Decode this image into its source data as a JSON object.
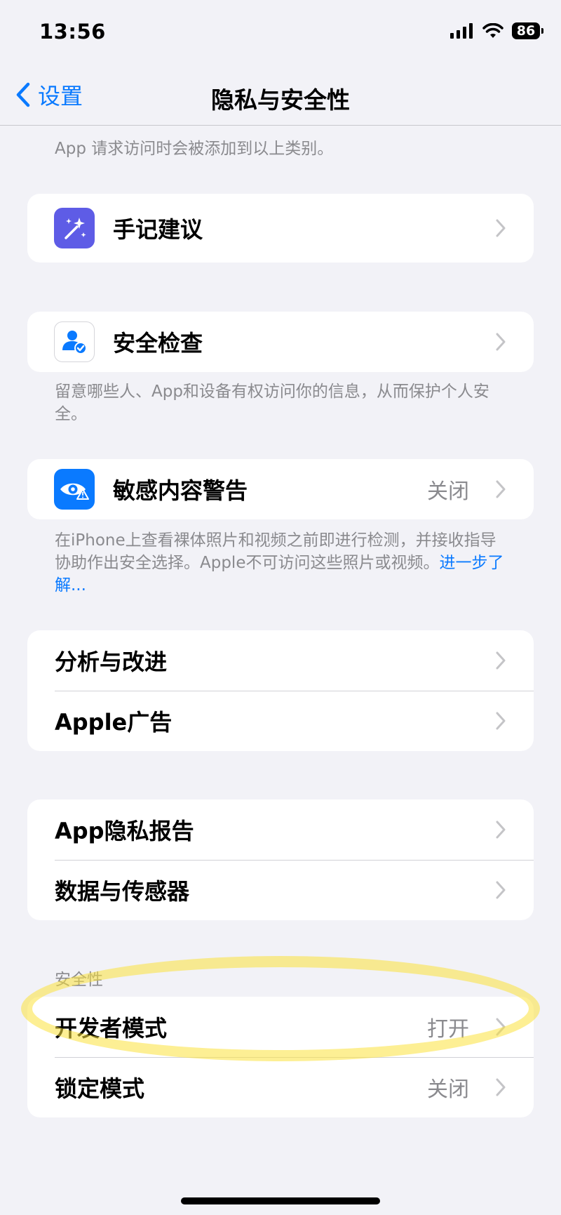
{
  "status": {
    "time": "13:56",
    "battery": "86"
  },
  "nav": {
    "back_label": "设置",
    "title": "隐私与安全性"
  },
  "top_note": "App 请求访问时会被添加到以上类别。",
  "journaling": {
    "label": "手记建议"
  },
  "safety_check": {
    "label": "安全检查",
    "footnote": "留意哪些人、App和设备有权访问你的信息，从而保护个人安全。"
  },
  "sensitive": {
    "label": "敏感内容警告",
    "value": "关闭",
    "footnote": "在iPhone上查看裸体照片和视频之前即进行检测，并接收指导协助作出安全选择。Apple不可访问这些照片或视频。",
    "link": "进一步了解..."
  },
  "group_analytics": {
    "items": [
      {
        "label": "分析与改进"
      },
      {
        "label": "Apple广告"
      }
    ]
  },
  "group_report": {
    "items": [
      {
        "label": "App隐私报告"
      },
      {
        "label": "数据与传感器"
      }
    ]
  },
  "security": {
    "header": "安全性",
    "items": [
      {
        "label": "开发者模式",
        "value": "打开"
      },
      {
        "label": "锁定模式",
        "value": "关闭"
      }
    ]
  },
  "colors": {
    "accent": "#0a7aff",
    "background": "#f2f2f7",
    "journal_icon": "#5e5ce6",
    "sensitive_icon": "#0a7aff",
    "highlight": "#fce23c"
  }
}
